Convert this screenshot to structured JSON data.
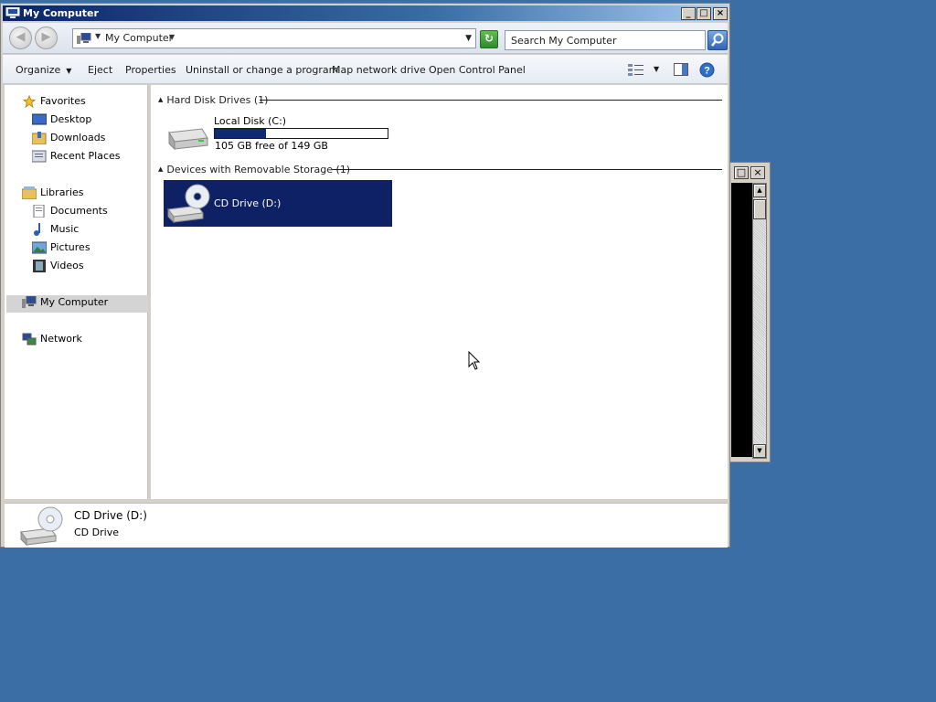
{
  "window": {
    "title": "My Computer",
    "controls": {
      "minimize": "_",
      "maximize": "□",
      "close": "×"
    }
  },
  "navbar": {
    "address_text": "My Computer",
    "search_placeholder": "Search My Computer"
  },
  "commands": {
    "organize": "Organize",
    "eject": "Eject",
    "properties": "Properties",
    "uninstall": "Uninstall or change a program",
    "map_drive": "Map network drive",
    "control_panel": "Open Control Panel"
  },
  "sidebar": {
    "favorites": "Favorites",
    "desktop": "Desktop",
    "downloads": "Downloads",
    "recent": "Recent Places",
    "libraries": "Libraries",
    "documents": "Documents",
    "music": "Music",
    "pictures": "Pictures",
    "videos": "Videos",
    "computer": "My Computer",
    "network": "Network"
  },
  "content": {
    "hdd_group": "Hard Disk Drives (1)",
    "local_disk_name": "Local Disk (C:)",
    "local_disk_free": "105 GB free of 149 GB",
    "local_disk_used_fraction": 0.295,
    "removable_group": "Devices with Removable Storage (1)",
    "cd_name": "CD Drive (D:)"
  },
  "details": {
    "name": "CD Drive (D:)",
    "type": "CD Drive"
  },
  "colors": {
    "desktop": "#3a6ea5",
    "selection": "#0d2164",
    "disk_bar": "#0e2a76"
  }
}
